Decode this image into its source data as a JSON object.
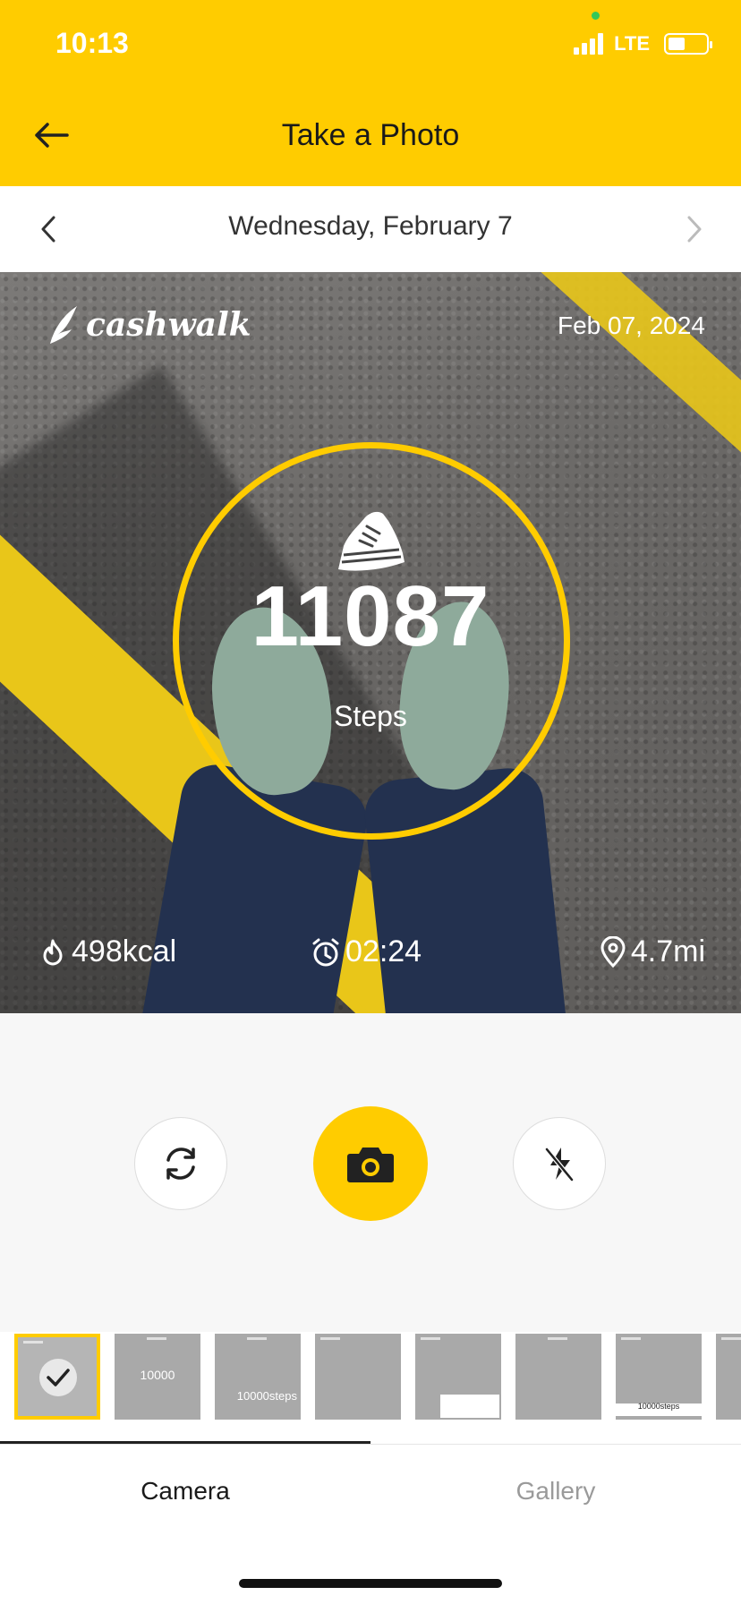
{
  "status_bar": {
    "time": "10:13",
    "network": "LTE"
  },
  "header": {
    "title": "Take a Photo",
    "back_icon": "back-arrow-icon"
  },
  "date_nav": {
    "label": "Wednesday, February 7",
    "prev_icon": "chevron-left-icon",
    "next_icon": "chevron-right-icon"
  },
  "photo": {
    "brand": "cashwalk",
    "date": "Feb 07, 2024",
    "steps_value": "11087",
    "steps_label": "Steps",
    "stats": {
      "calories": "498kcal",
      "duration": "02:24",
      "distance": "4.7mi"
    }
  },
  "controls": {
    "switch_camera_icon": "switch-camera-icon",
    "shutter_icon": "camera-icon",
    "flash_icon": "flash-off-icon"
  },
  "thumbnails": [
    {
      "label": "",
      "selected": true
    },
    {
      "label": "10000"
    },
    {
      "label": "10000steps"
    },
    {
      "label": ""
    },
    {
      "label": ""
    },
    {
      "label": ""
    },
    {
      "label": "10000steps"
    },
    {
      "label": ""
    }
  ],
  "tabs": {
    "camera": "Camera",
    "gallery": "Gallery"
  },
  "colors": {
    "accent": "#FFCC00",
    "inactive_tab": "#9a9a9a"
  }
}
